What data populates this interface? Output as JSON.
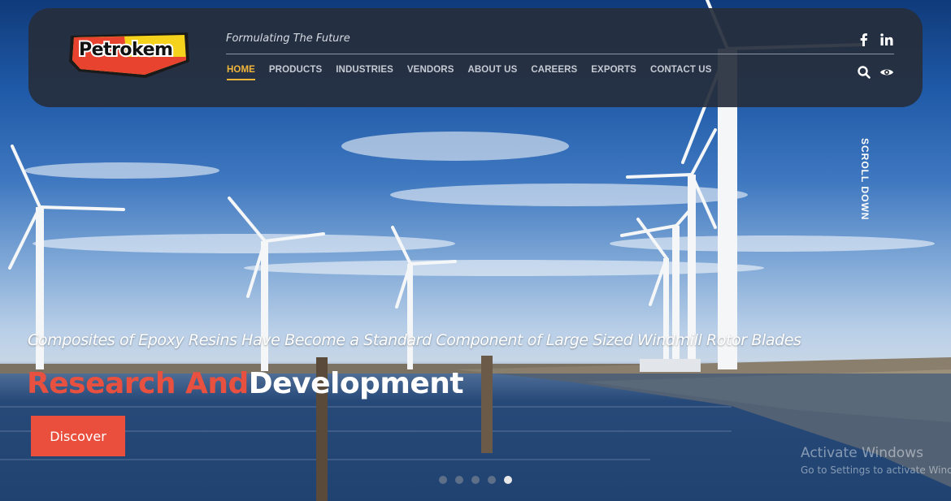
{
  "brand": {
    "logo_text": "Petrokem",
    "tagline": "Formulating The Future"
  },
  "nav": {
    "items": [
      {
        "label": "HOME",
        "active": true
      },
      {
        "label": "PRODUCTS"
      },
      {
        "label": "INDUSTRIES"
      },
      {
        "label": "VENDORS"
      },
      {
        "label": "ABOUT US"
      },
      {
        "label": "CAREERS"
      },
      {
        "label": "EXPORTS"
      },
      {
        "label": "CONTACT US"
      }
    ]
  },
  "header_icons": {
    "social": [
      "facebook-icon",
      "linkedin-icon"
    ],
    "tools": [
      "search-icon",
      "eye-icon"
    ]
  },
  "scroll_label": "SCROLL DOWN",
  "slide": {
    "subtitle": "Composites of Epoxy Resins Have Become a Standard Component of Large Sized Windmill Rotor Blades",
    "title_part1": "Research And",
    "title_part2": "Development",
    "button": "Discover"
  },
  "pager": {
    "count": 5,
    "active_index": 4
  },
  "watermark": {
    "line1": "Activate Windows",
    "line2": "Go to Settings to activate Windows."
  },
  "colors": {
    "accent": "#f3b53a",
    "cta": "#ea4f3d",
    "header_bg": "#262e3c"
  }
}
